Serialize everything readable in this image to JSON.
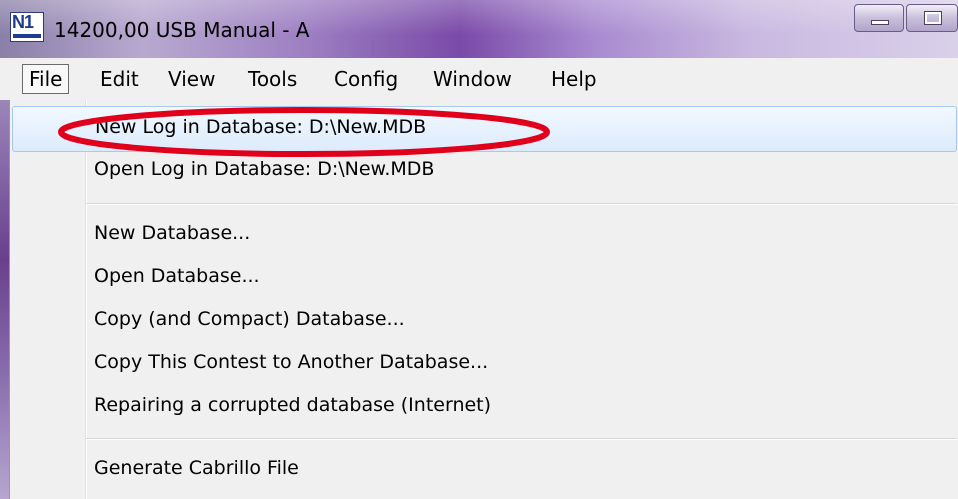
{
  "window": {
    "title": "14200,00 USB Manual - A",
    "icon": "n1mm-logo-icon"
  },
  "menubar": {
    "items": [
      {
        "label": "File"
      },
      {
        "label": "Edit"
      },
      {
        "label": "View"
      },
      {
        "label": "Tools"
      },
      {
        "label": "Config"
      },
      {
        "label": "Window"
      },
      {
        "label": "Help"
      }
    ],
    "active": "File"
  },
  "file_menu": {
    "items": [
      {
        "label": "New Log in Database: D:\\New.MDB",
        "highlighted": true
      },
      {
        "label": "Open Log in Database: D:\\New.MDB"
      },
      {
        "label": "New Database..."
      },
      {
        "label": "Open Database..."
      },
      {
        "label": "Copy (and Compact) Database..."
      },
      {
        "label": "Copy This Contest to Another Database..."
      },
      {
        "label": "Repairing a corrupted database (Internet)"
      },
      {
        "label": "Generate Cabrillo File"
      }
    ]
  },
  "colors": {
    "annotation_ellipse": "#e0001b",
    "highlight_border": "#a8c8ec",
    "menu_background": "#f0f0f0"
  }
}
